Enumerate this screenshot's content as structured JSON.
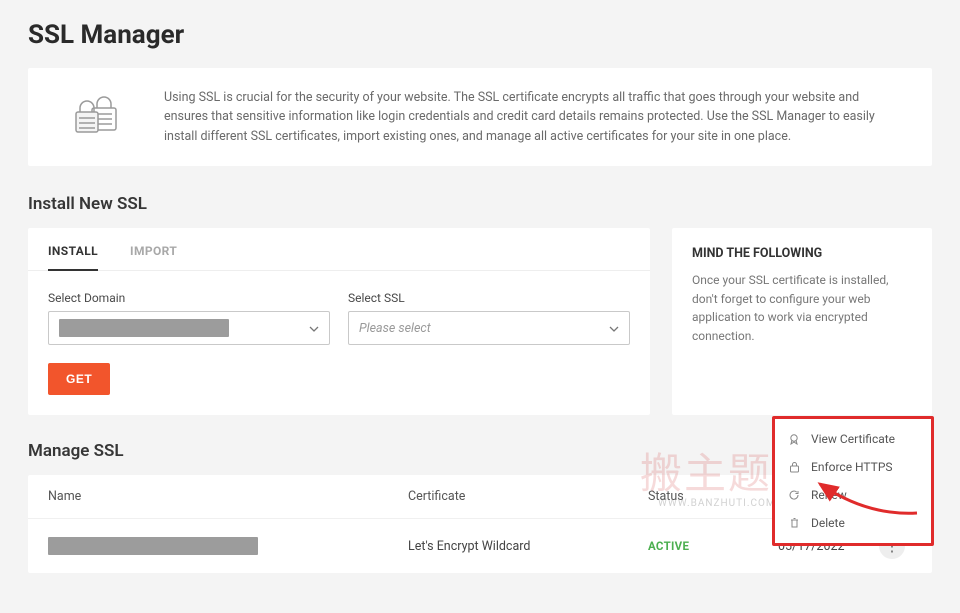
{
  "page_title": "SSL Manager",
  "banner": {
    "description": "Using SSL is crucial for the security of your website. The SSL certificate encrypts all traffic that goes through your website and ensures that sensitive information like login credentials and credit card details remains protected. Use the SSL Manager to easily install different SSL certificates, import existing ones, and manage all active certificates for your site in one place."
  },
  "install_section": {
    "heading": "Install New SSL",
    "tabs": {
      "install": "INSTALL",
      "import": "IMPORT"
    },
    "domain_label": "Select Domain",
    "ssl_label": "Select SSL",
    "ssl_placeholder": "Please select",
    "get_button": "GET"
  },
  "side_note": {
    "title": "MIND THE FOLLOWING",
    "body": "Once your SSL certificate is installed, don't forget to configure your web application to work via encrypted connection."
  },
  "manage_section": {
    "heading": "Manage SSL",
    "columns": {
      "name": "Name",
      "certificate": "Certificate",
      "status": "Status"
    },
    "row": {
      "certificate": "Let's Encrypt Wildcard",
      "status": "ACTIVE",
      "date": "05/17/2022"
    }
  },
  "menu": {
    "view": "View Certificate",
    "enforce": "Enforce HTTPS",
    "renew": "Renew",
    "delete": "Delete"
  },
  "watermark_text": "搬主题"
}
